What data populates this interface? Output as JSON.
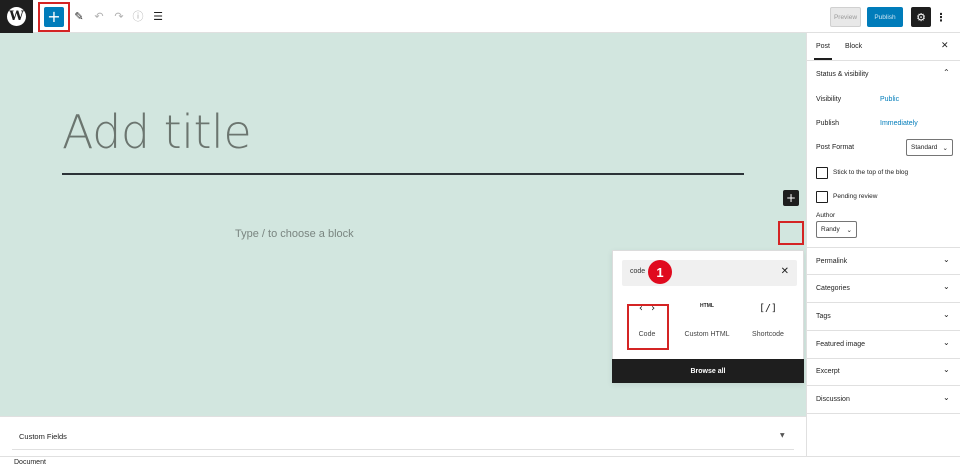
{
  "toolbar": {
    "logo_glyph": "W",
    "add_block_glyph": "+",
    "tools_icon": "pencil-icon",
    "undo_icon": "undo-icon",
    "redo_icon": "redo-icon",
    "details_icon": "info-icon",
    "outline_icon": "list-view-icon",
    "preview_label": "Preview",
    "publish_label": "Publish",
    "settings_icon": "gear-icon",
    "more_glyph": "⋮",
    "brand_color": "#007cba"
  },
  "editor": {
    "title_placeholder": "Add title",
    "block_placeholder": "Type / to choose a block",
    "inline_add_glyph": "+",
    "canvas_color": "#d2e6df"
  },
  "inserter": {
    "search_value": "code",
    "clear_glyph": "✕",
    "step_number": "1",
    "blocks": [
      {
        "label": "Code",
        "icon_glyph": "‹ ›"
      },
      {
        "label": "Custom HTML",
        "icon_glyph": "HTML"
      },
      {
        "label": "Shortcode",
        "icon_glyph": "[/]"
      }
    ],
    "browse_all_label": "Browse all"
  },
  "metabox": {
    "title": "Custom Fields",
    "caret": "▼"
  },
  "footer": {
    "breadcrumb": "Document"
  },
  "sidebar": {
    "tabs": [
      "Post",
      "Block"
    ],
    "close_glyph": "✕",
    "status": {
      "heading": "Status & visibility",
      "visibility_label": "Visibility",
      "visibility_value": "Public",
      "publish_label": "Publish",
      "publish_value": "Immediately",
      "post_format_label": "Post Format",
      "post_format_value": "Standard",
      "stick_label": "Stick to the top of the blog",
      "pending_label": "Pending review",
      "author_label": "Author",
      "author_value": "Randy"
    },
    "panels": [
      "Permalink",
      "Categories",
      "Tags",
      "Featured image",
      "Excerpt",
      "Discussion"
    ],
    "chevron_up": "⌃",
    "chevron_down": "⌄"
  }
}
